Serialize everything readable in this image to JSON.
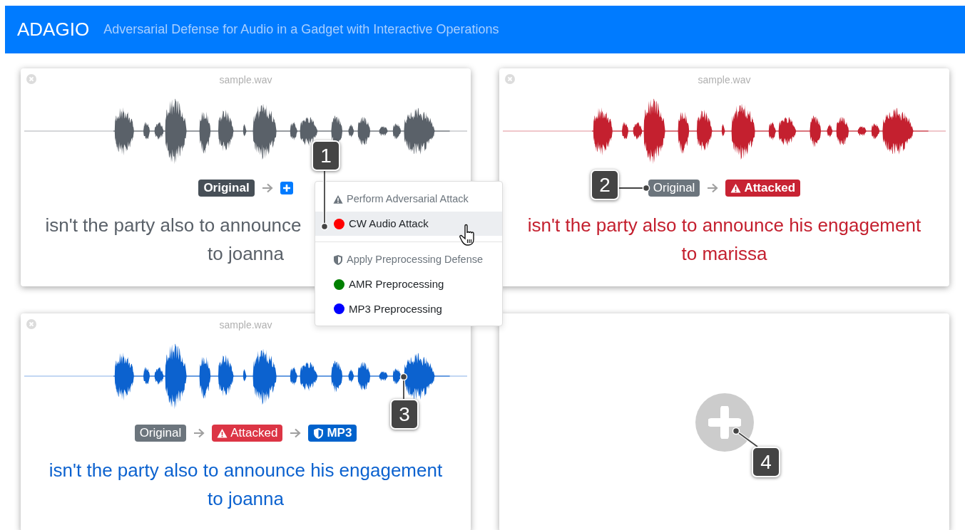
{
  "header": {
    "title": "ADAGIO",
    "subtitle": "Adversarial Defense for Audio in a Gadget with Interactive Operations"
  },
  "panels": [
    {
      "kind": "audio",
      "filename": "sample.wav",
      "color": "#5a6169",
      "transcript_covered": true,
      "pipeline": [
        {
          "kind": "original",
          "label": "Original",
          "selected": true
        },
        {
          "kind": "add"
        }
      ],
      "transcript": [
        "isn't the party also to announce",
        "to joanna"
      ]
    },
    {
      "kind": "audio",
      "filename": "sample.wav",
      "color": "#c4202f",
      "transcript_covered": false,
      "pipeline": [
        {
          "kind": "original",
          "label": "Original",
          "selected": false
        },
        {
          "kind": "attacked",
          "label": "Attacked",
          "selected": true
        }
      ],
      "transcript": [
        "isn't the party also to announce his engagement",
        "to marissa"
      ]
    },
    {
      "kind": "audio",
      "filename": "sample.wav",
      "color": "#0c62cf",
      "transcript_covered": false,
      "pipeline": [
        {
          "kind": "original",
          "label": "Original",
          "selected": false
        },
        {
          "kind": "attacked",
          "label": "Attacked",
          "selected": false
        },
        {
          "kind": "defense",
          "label": "MP3",
          "selected": true
        }
      ],
      "transcript": [
        "isn't the party also to announce his engagement",
        "to joanna"
      ]
    },
    {
      "kind": "empty"
    }
  ],
  "menu": {
    "sections": [
      {
        "kind": "attack",
        "header": "Perform Adversarial Attack",
        "items": [
          {
            "label": "CW Audio Attack",
            "color": "#ff0000",
            "highlighted": true
          }
        ]
      },
      {
        "kind": "defense",
        "header": "Apply Preprocessing Defense",
        "items": [
          {
            "label": "AMR Preprocessing",
            "color": "#008000",
            "highlighted": false
          },
          {
            "label": "MP3 Preprocessing",
            "color": "#0000ff",
            "highlighted": false
          }
        ]
      }
    ]
  },
  "callouts": [
    {
      "label": "1"
    },
    {
      "label": "2"
    },
    {
      "label": "3"
    },
    {
      "label": "4"
    }
  ]
}
